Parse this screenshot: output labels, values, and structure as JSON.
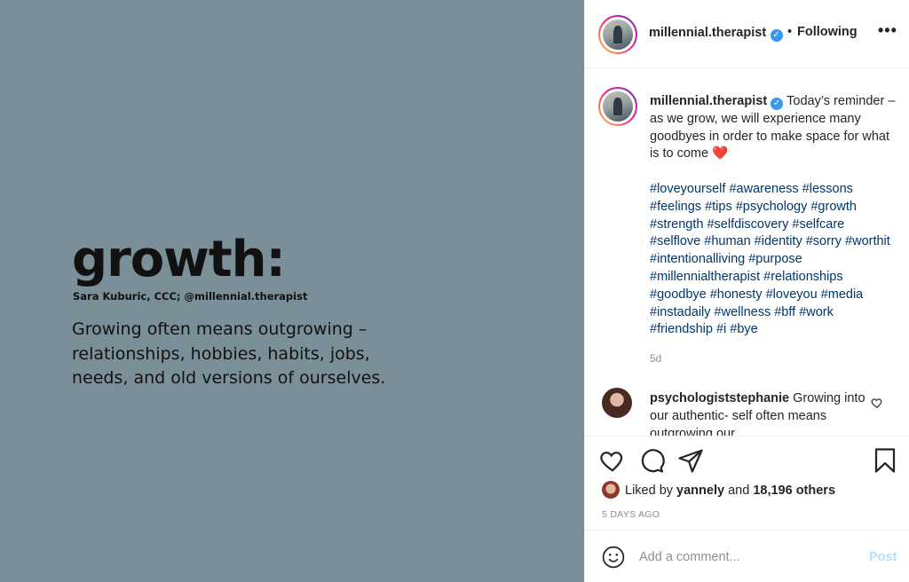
{
  "image": {
    "title": "growth:",
    "author": "Sara Kuburic, CCC; @millennial.therapist",
    "body": "Growing often means outgrowing – relationships, hobbies, habits, jobs, needs, and old versions of ourselves.",
    "background_color": "#7a8f98"
  },
  "header": {
    "username": "millennial.therapist",
    "verified_icon": "verified-badge-icon",
    "separator": "•",
    "follow_status": "Following",
    "more_icon": "more-options-icon",
    "more_glyph": "•••"
  },
  "caption": {
    "username": "millennial.therapist",
    "text": "Today’s reminder – as we grow, we will experience many goodbyes in order to make space for what is to come ❤️",
    "hashtags": "#loveyourself #awareness #lessons #feelings #tips #psychology #growth #strength #selfdiscovery #selfcare #selflove #human #identity #sorry #worthit #intentionalliving #purpose #millennialtherapist #relationships #goodbye #honesty #loveyou #media #instadaily #wellness #bff #work #friendship #i #bye",
    "time": "5d"
  },
  "comment": {
    "username": "psychologiststephanie",
    "text": "Growing into our authentic- self often means outgrowing our"
  },
  "actions": {
    "icons": [
      "heart-icon",
      "comment-icon",
      "share-icon",
      "bookmark-icon"
    ],
    "liked_by_prefix": "Liked by",
    "liked_by_user": "yannely",
    "liked_by_and": "and",
    "likes_count": "18,196 others",
    "date": "5 DAYS AGO"
  },
  "add_comment": {
    "placeholder": "Add a comment...",
    "post_label": "Post",
    "emoji_icon": "smiley-icon"
  },
  "colors": {
    "hashtag": "#00376b",
    "verified": "#3897f0",
    "muted": "#8e8e8e",
    "post_disabled": "#b2dffc"
  }
}
